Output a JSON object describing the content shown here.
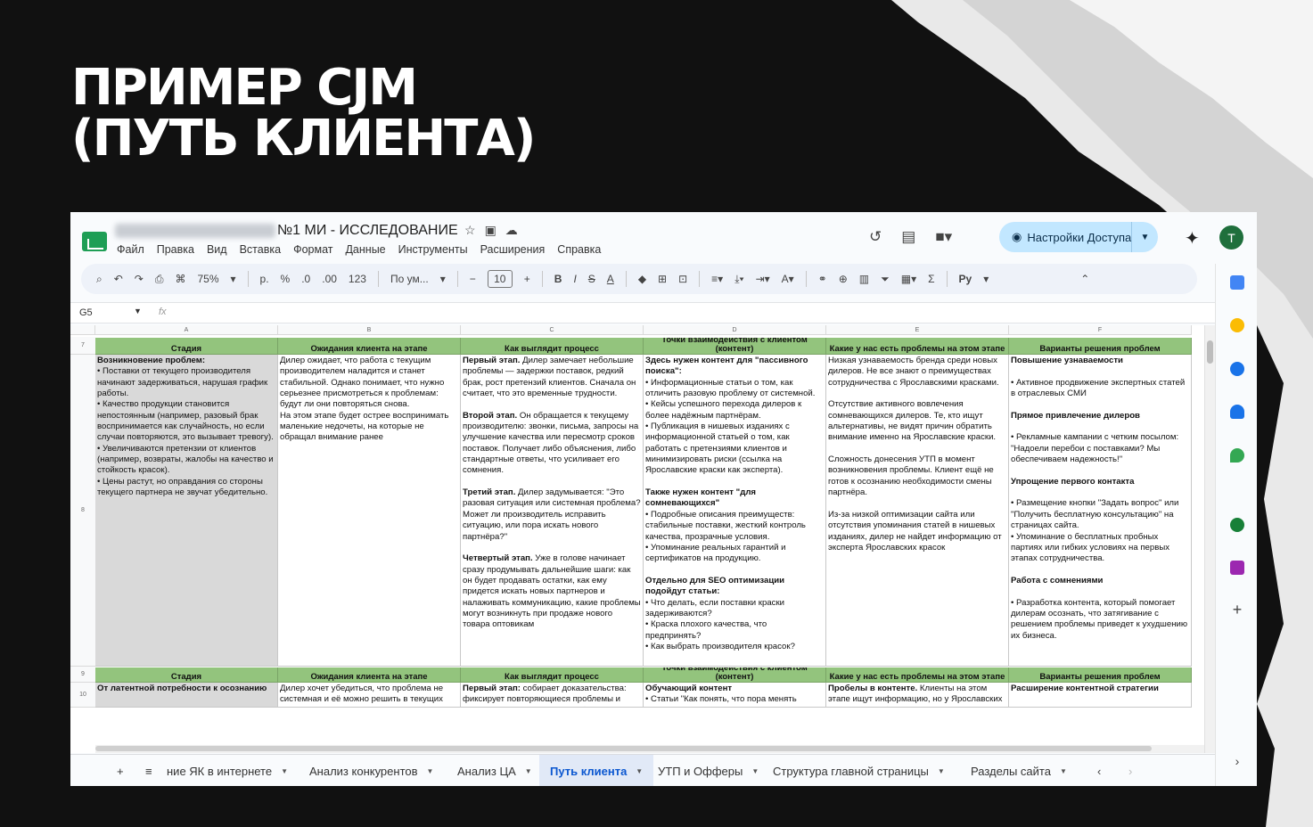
{
  "headline": {
    "line1": "ПРИМЕР CJM",
    "line2": "(ПУТЬ КЛИЕНТА)"
  },
  "app": {
    "doc_title": "№1 МИ - ИССЛЕДОВАНИЕ",
    "menu": [
      "Файл",
      "Правка",
      "Вид",
      "Вставка",
      "Формат",
      "Данные",
      "Инструменты",
      "Расширения",
      "Справка"
    ],
    "access_button": "Настройки Доступа",
    "avatar_letter": "T",
    "toolbar": {
      "zoom": "75%",
      "currency": "р.",
      "percent": "%",
      "dec_minus": ".0",
      "dec_plus": ".00",
      "number_format": "123",
      "font": "По ум...",
      "font_size": "10",
      "bold": "B",
      "italic": "I",
      "strike": "S",
      "text_color": "A",
      "script": "Py"
    },
    "name_box": "G5",
    "fx": "fx"
  },
  "columns": [
    "A",
    "B",
    "C",
    "D",
    "E",
    "F"
  ],
  "rows": [
    {
      "num": "7",
      "headers": [
        "Стадия",
        "Ожидания клиента на этапе",
        "Как выглядит процесс",
        "Точки взаимодействия с клиентом (контент)",
        "Какие у нас есть проблемы на этом этапе",
        "Варианты решения проблем"
      ]
    },
    {
      "num": "8",
      "cells": [
        "<b>Возникновение проблем:</b>\n• Поставки от текущего производителя начинают задерживаться, нарушая график работы.\n• Качество продукции становится непостоянным (например, разовый брак воспринимается как случайность, но если случаи повторяются, это вызывает тревогу).\n• Увеличиваются претензии от клиентов (например, возвраты, жалобы на качество и стойкость красок).\n• Цены растут, но оправдания со стороны текущего партнера не звучат убедительно.",
        "Дилер ожидает, что работа с текущим производителем наладится и станет стабильной. Однако понимает, что нужно серьезнее присмотреться к проблемам: будут ли они повторяться снова.\nНа этом этапе будет острее воспринимать маленькие недочеты, на которые не обращал внимание ранее",
        "<b>Первый этап.</b> Дилер замечает небольшие проблемы — задержки поставок, редкий брак, рост претензий клиентов. Сначала он считает, что это временные трудности.\n\n<b>Второй этап.</b> Он обращается к текущему производителю: звонки, письма, запросы на улучшение качества или пересмотр сроков поставок. Получает либо объяснения, либо стандартные ответы, что усиливает его сомнения.\n\n<b>Третий этап.</b> Дилер задумывается: \"Это разовая ситуация или системная проблема? Может ли производитель исправить ситуацию, или пора искать нового партнёра?\"\n\n<b>Четвертый этап.</b> Уже в голове начинает сразу продумывать дальнейшие шаги: как он будет продавать остатки, как ему придется искать новых партнеров и налаживать коммуникацию, какие проблемы могут возникнуть при продаже нового товара оптовикам",
        "<b>Здесь нужен контент для \"пассивного поиска\":</b>\n• Информационные статьи о том, как отличить разовую проблему от системной.\n• Кейсы успешного перехода дилеров к более надёжным партнёрам.\n• Публикация в нишевых изданиях с информационной статьей о том, как работать с претензиями клиентов и минимизировать риски (ссылка на Ярославские краски как эксперта).\n\n<b>Также нужен контент \"для сомневающихся\"</b>\n• Подробные описания преимуществ: стабильные поставки, жесткий контроль качества, прозрачные условия.\n• Упоминание реальных гарантий и сертификатов на продукцию.\n\n<b>Отдельно для SEO оптимизации подойдут статьи:</b>\n• Что делать, если поставки краски задерживаются?\n• Краска плохого качества, что предпринять?\n• Как выбрать производителя красок?",
        "Низкая узнаваемость бренда среди новых дилеров. Не все знают о преимуществах сотрудничества с Ярославскими красками.\n\nОтсутствие активного вовлечения сомневающихся дилеров. Те, кто ищут альтернативы, не видят причин обратить внимание именно на Ярославские краски.\n\nСложность донесения УТП в момент возникновения проблемы. Клиент ещё не готов к осознанию необходимости смены партнёра.\n\nИз-за низкой оптимизации сайта или отсутствия упоминания статей в нишевых изданиях, дилер не найдет информацию от эксперта Ярославских красок",
        "<b>Повышение узнаваемости</b>\n\n• Активное продвижение экспертных статей в отраслевых СМИ\n\n<b>Прямое привлечение дилеров</b>\n\n• Рекламные кампании с четким посылом: \"Надоели перебои с поставками? Мы обеспечиваем надежность!\"\n\n<b>Упрощение первого контакта</b>\n\n• Размещение кнопки \"Задать вопрос\" или \"Получить бесплатную консультацию\" на страницах сайта.\n• Упоминание о бесплатных пробных партиях или гибких условиях на первых этапах сотрудничества.\n\n<b>Работа с сомнениями</b>\n\n• Разработка контента, который помогает дилерам осознать, что затягивание с решением проблемы приведет к ухудшению их бизнеса."
      ]
    },
    {
      "num": "9",
      "headers": [
        "Стадия",
        "Ожидания клиента на этапе",
        "Как выглядит процесс",
        "Точки взаимодействия с клиентом (контент)",
        "Какие у нас есть проблемы на этом этапе",
        "Варианты решения проблем"
      ]
    },
    {
      "num": "10",
      "cells": [
        "<b>От латентной потребности к осознанию</b>",
        "Дилер хочет убедиться, что проблема не системная и её можно решить в текущих условиях. Ожидает улучшений от текущего производителя: оперативных ответов, изменений в условиях",
        "<b>Первый этап:</b> собирает доказательства: фиксирует повторяющиеся проблемы и анализирует тенденции: \"Проблемы стали чаще? Ухудшилась ли репутация среди клиентов?\"",
        "<b>Обучающий контент</b>\n• Статьи \"Как понять, что пора менять поставщика?\", \"Чем опасны системные проблемы с качеством продукции?\"\n• Чек-листы \"Как проверить",
        "<b>Пробелы в контенте.</b> Клиенты на этом этапе ищут информацию, но у Ярославских красок может быть недостаточно материалов, чтобы вовлечь дилеров",
        "<b>Расширение контентной стратегии</b>\n\n• Регулярное создание статей, инфографики, чек-листов, кейсов, которые помогают дилерам на этом"
      ]
    }
  ],
  "sheet_tabs": [
    {
      "label": "ние ЯК в интернете",
      "active": false
    },
    {
      "label": "Анализ конкурентов",
      "active": false
    },
    {
      "label": "Анализ ЦА",
      "active": false
    },
    {
      "label": "Путь клиента",
      "active": true
    },
    {
      "label": "УТП и Офферы",
      "active": false
    },
    {
      "label": "Структура главной страницы",
      "active": false
    },
    {
      "label": "Разделы сайта",
      "active": false
    }
  ],
  "colors": {
    "header_green": "#93c47d",
    "stage_grey": "#d9d9d9",
    "access_blue": "#c2e7ff",
    "active_tab": "#0b57d0"
  }
}
